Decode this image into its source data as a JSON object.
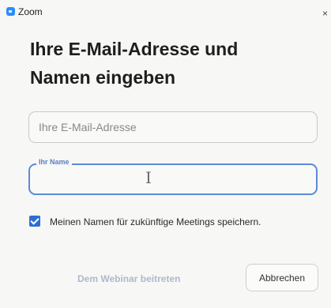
{
  "window": {
    "app_title": "Zoom",
    "close_label": "×"
  },
  "heading": {
    "line1": "Ihre E-Mail-Adresse und",
    "line2": "Namen eingeben"
  },
  "email": {
    "placeholder": "Ihre E-Mail-Adresse",
    "value": ""
  },
  "name": {
    "label": "Ihr Name",
    "value": ""
  },
  "remember": {
    "checked": true,
    "label": "Meinen Namen für zukünftige Meetings speichern."
  },
  "buttons": {
    "join_label": "Dem Webinar beitreten",
    "cancel_label": "Abbrechen"
  },
  "colors": {
    "accent": "#2d8cff",
    "focus_border": "#5b8bd6",
    "checkbox": "#2d6fd1",
    "disabled_text": "#b0b8cc"
  },
  "icons": {
    "app": "zoom-logo-icon",
    "cursor": "text-cursor-icon",
    "checkbox": "checkmark-icon"
  }
}
